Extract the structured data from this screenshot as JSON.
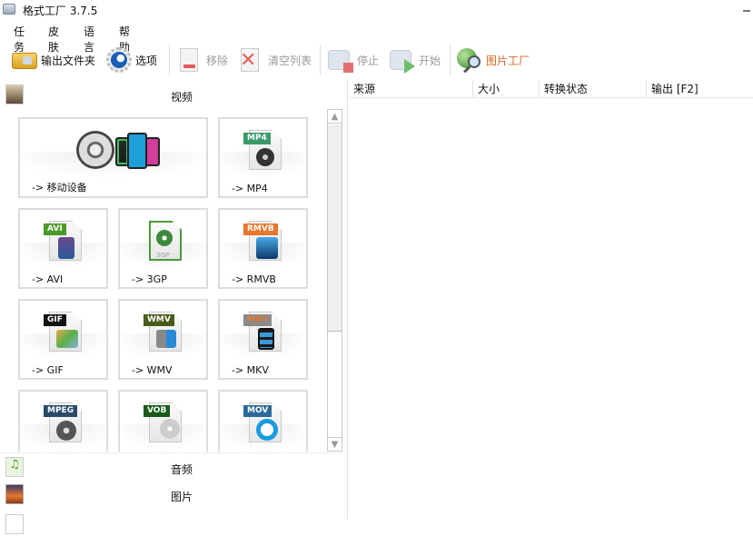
{
  "window": {
    "title": "格式工厂 3.7.5"
  },
  "menu": [
    "任务",
    "皮肤",
    "语言",
    "帮助"
  ],
  "toolbar": {
    "output_folder": "输出文件夹",
    "options": "选项",
    "remove": "移除",
    "clear_list": "清空列表",
    "stop": "停止",
    "start": "开始",
    "picture_factory": "图片工厂"
  },
  "categories": {
    "video": "视频",
    "audio": "音频",
    "picture": "图片"
  },
  "video_formats": [
    {
      "label": "-> 移动设备",
      "tag": ""
    },
    {
      "label": "-> MP4",
      "tag": "MP4",
      "color": "#3a9a6a"
    },
    {
      "label": "-> AVI",
      "tag": "AVI",
      "color": "#4a9a2a"
    },
    {
      "label": "-> 3GP",
      "tag": "3GP",
      "color": "#5a9a3a"
    },
    {
      "label": "-> RMVB",
      "tag": "RMVB",
      "color": "#e8762c"
    },
    {
      "label": "-> GIF",
      "tag": "GIF",
      "color": "#111111"
    },
    {
      "label": "-> WMV",
      "tag": "WMV",
      "color": "#4a5a1a"
    },
    {
      "label": "-> MKV",
      "tag": "MKV",
      "color": "#8a8a8a"
    },
    {
      "label": "",
      "tag": "MPEG",
      "color": "#2a4a6a"
    },
    {
      "label": "",
      "tag": "VOB",
      "color": "#1a5a1a"
    },
    {
      "label": "",
      "tag": "MOV",
      "color": "#2a6a9a"
    }
  ],
  "table": {
    "columns": [
      "来源",
      "大小",
      "转换状态",
      "输出 [F2]"
    ]
  },
  "scrollbar": {
    "position_fraction": 0.0,
    "visible_fraction": 0.63
  }
}
